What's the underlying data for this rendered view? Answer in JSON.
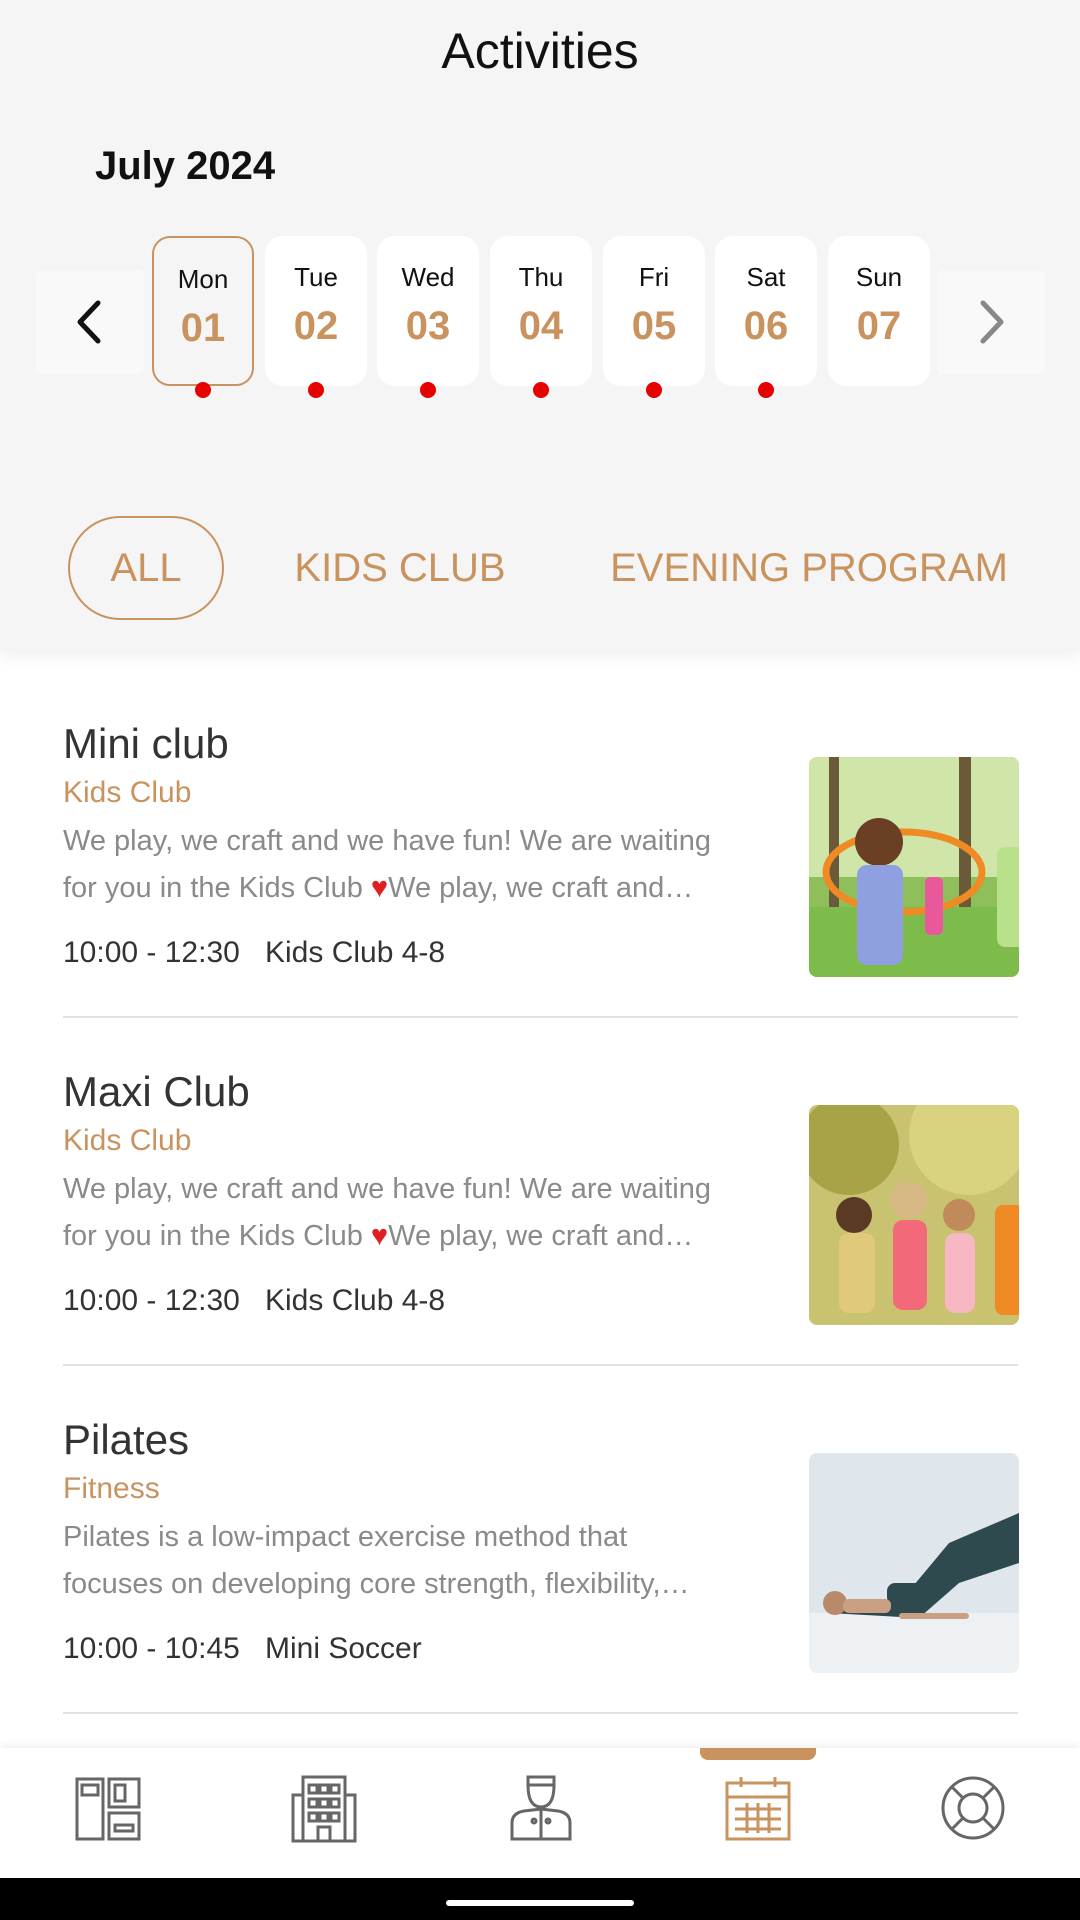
{
  "header": {
    "title": "Activities",
    "month": "July 2024"
  },
  "calendar": {
    "days": [
      {
        "name": "Mon",
        "num": "01",
        "selected": true
      },
      {
        "name": "Tue",
        "num": "02"
      },
      {
        "name": "Wed",
        "num": "03"
      },
      {
        "name": "Thu",
        "num": "04"
      },
      {
        "name": "Fri",
        "num": "05"
      },
      {
        "name": "Sat",
        "num": "06"
      },
      {
        "name": "Sun",
        "num": "07"
      }
    ]
  },
  "filters": [
    "ALL",
    "KIDS CLUB",
    "EVENING PROGRAM"
  ],
  "activities": [
    {
      "name": "Mini club",
      "category": "Kids Club",
      "desc_line1": "We play, we craft and we have fun! We are waiting",
      "desc_line2_pre": "for you in the Kids Club ",
      "desc_line2_post": "We play, we craft and…",
      "time": "10:00 - 12:30",
      "location": "Kids Club 4-8"
    },
    {
      "name": "Maxi Club",
      "category": "Kids Club",
      "desc_line1": "We play, we craft and we have fun! We are waiting",
      "desc_line2_pre": "for you in the Kids Club ",
      "desc_line2_post": "We play, we craft and…",
      "time": "10:00 - 12:30",
      "location": "Kids Club 4-8"
    },
    {
      "name": "Pilates",
      "category": "Fitness",
      "desc_line1": "Pilates is a low-impact exercise method that",
      "desc_line2_pre": "focuses on developing core strength, flexibility,…",
      "desc_line2_post": "",
      "time": "10:00 - 10:45",
      "location": "Mini Soccer"
    }
  ],
  "glyphs": {
    "heart": "♥"
  },
  "tabs": [
    "dashboard-icon",
    "hotel-icon",
    "concierge-icon",
    "calendar-icon",
    "lifebuoy-icon"
  ],
  "colors": {
    "accent": "#c9935f",
    "event_dot": "#e60000",
    "header_bg": "#f5f5f5"
  }
}
